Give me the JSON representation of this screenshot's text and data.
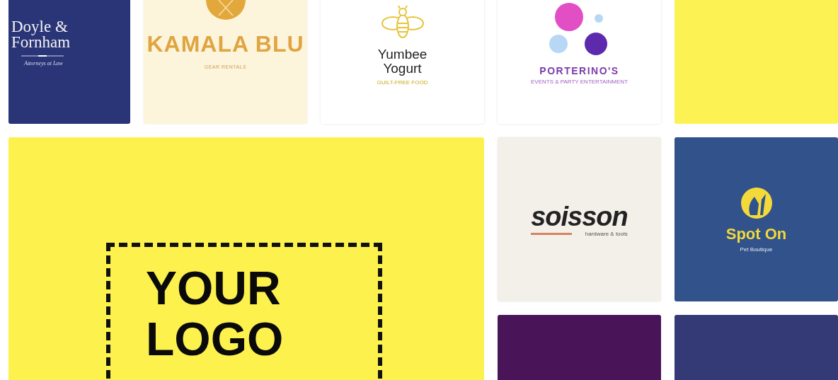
{
  "templates": [
    {
      "kind": "law",
      "name": "Doyle & Fornham",
      "tagline": "Attorneys at Law"
    },
    {
      "kind": "crest",
      "name": "KAMALA BLU",
      "tagline": "GEAR RENTALS"
    },
    {
      "kind": "bee",
      "name": "Yumbee Yogurt",
      "tagline": "GUILT-FREE FOOD"
    },
    {
      "kind": "bubbles",
      "name": "PORTERINO'S",
      "tagline": "EVENTS & PARTY ENTERTAINMENT"
    },
    {
      "kind": "blank"
    },
    {
      "kind": "placeholder",
      "lines": [
        "YOUR",
        "LOGO"
      ]
    },
    {
      "kind": "underline",
      "name": "soisson",
      "tagline": "hardware & tools"
    },
    {
      "kind": "emblem",
      "name": "Spot On",
      "tagline": "Pet Boutique"
    },
    {
      "kind": "lotus"
    },
    {
      "kind": "planet"
    }
  ]
}
